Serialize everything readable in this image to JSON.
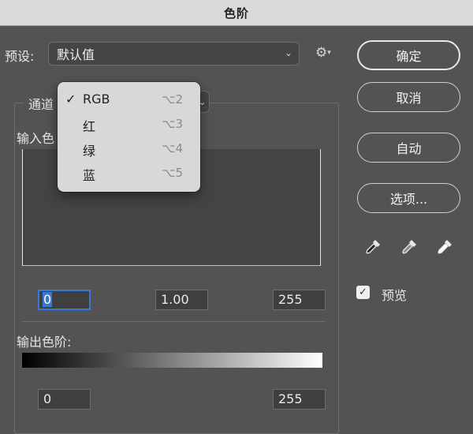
{
  "dialog": {
    "title": "色阶"
  },
  "preset": {
    "label": "预设:",
    "value": "默认值"
  },
  "buttons": {
    "ok": "确定",
    "cancel": "取消",
    "auto": "自动",
    "options": "选项..."
  },
  "channel": {
    "label": "通道"
  },
  "input_levels": {
    "label": "输入色",
    "black": "0",
    "gray": "1.00",
    "white": "255"
  },
  "output_levels": {
    "label": "输出色阶:",
    "black": "0",
    "white": "255"
  },
  "preview": {
    "label": "预览",
    "checked": true
  },
  "channel_menu": {
    "items": [
      {
        "label": "RGB",
        "shortcut": "⌥2",
        "checked": true,
        "check_mark": "✓"
      },
      {
        "label": "红",
        "shortcut": "⌥3",
        "checked": false,
        "check_mark": ""
      },
      {
        "label": "绿",
        "shortcut": "⌥4",
        "checked": false,
        "check_mark": ""
      },
      {
        "label": "蓝",
        "shortcut": "⌥5",
        "checked": false,
        "check_mark": ""
      }
    ]
  },
  "icons": {
    "gear": "gear-icon",
    "chevron": "chevron-down-icon",
    "eyedroppers": [
      "black-point-eyedropper-icon",
      "gray-point-eyedropper-icon",
      "white-point-eyedropper-icon"
    ]
  },
  "colors": {
    "accent": "#3b78d3",
    "background": "#535353"
  }
}
